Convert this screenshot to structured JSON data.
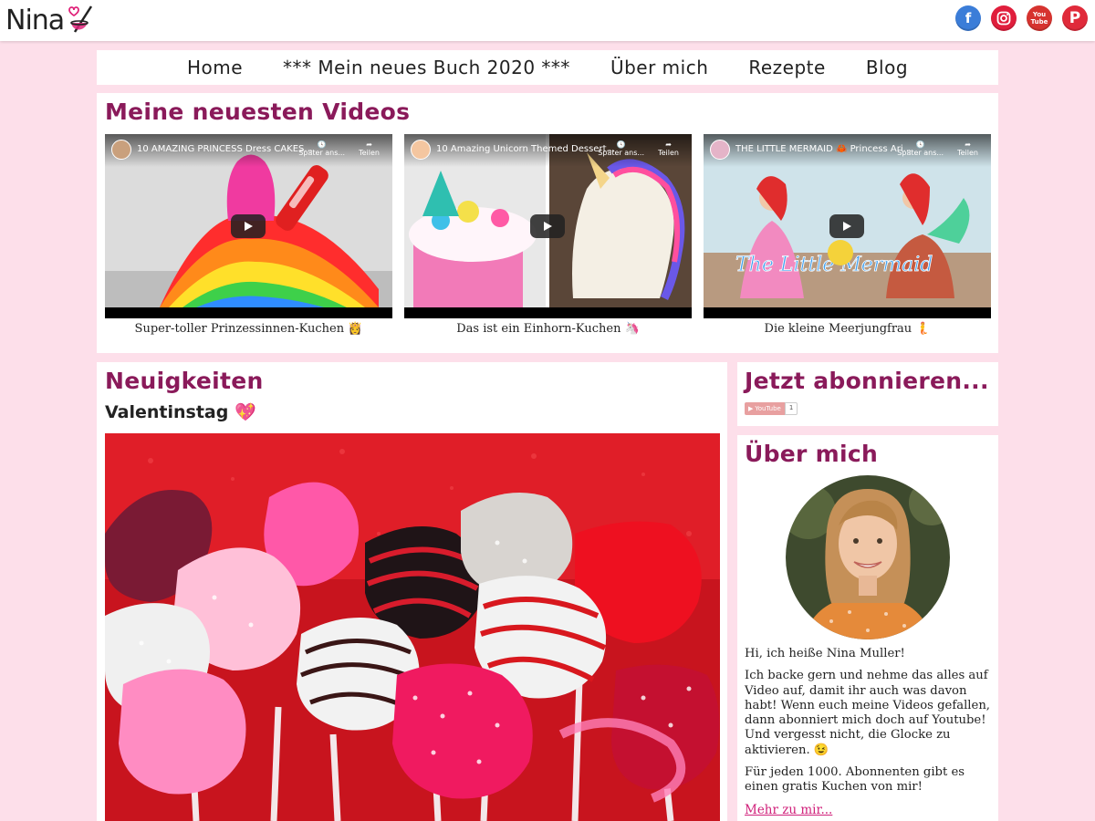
{
  "brand": {
    "logo_text": "Nina"
  },
  "social": [
    {
      "name": "facebook",
      "glyph": "f",
      "color": "#3b7dd8"
    },
    {
      "name": "instagram",
      "glyph": "◎",
      "color": "#e01e3c"
    },
    {
      "name": "youtube",
      "glyph": "You\nTube",
      "color": "#d6332f"
    },
    {
      "name": "pinterest",
      "glyph": "P",
      "color": "#e02a3a"
    }
  ],
  "nav": {
    "items": [
      {
        "label": "Home"
      },
      {
        "label": "*** Mein neues Buch 2020 ***"
      },
      {
        "label": "Über mich"
      },
      {
        "label": "Rezepte"
      },
      {
        "label": "Blog"
      }
    ]
  },
  "videos": {
    "heading": "Meine neuesten Videos",
    "items": [
      {
        "title": "10 AMAZING PRINCESS Dress CAKES...",
        "later": "Später ans...",
        "share": "Teilen",
        "caption": "Super-toller Prinzessinnen-Kuchen 👸"
      },
      {
        "title": "10 Amazing Unicorn Themed Dessert...",
        "later": "Später ans...",
        "share": "Teilen",
        "caption": "Das ist ein Einhorn-Kuchen 🦄"
      },
      {
        "title": "THE LITTLE MERMAID 🦀 Princess Ari...",
        "later": "Später ans...",
        "share": "Teilen",
        "caption": "Die kleine Meerjungfrau 🧜",
        "overlay_text": "The Little Mermaid"
      }
    ]
  },
  "news": {
    "heading": "Neuigkeiten",
    "post_title": "Valentinstag 💖"
  },
  "subscribe": {
    "heading": "Jetzt abonnieren...",
    "button_label": "YouTube",
    "count": "1"
  },
  "about": {
    "heading": "Über mich",
    "greeting": "Hi, ich heiße Nina Muller!",
    "paragraph": "Ich backe gern und nehme das alles auf Video auf, damit ihr auch was davon habt! Wenn euch meine Videos gefallen, dann abonniert mich doch auf Youtube! Und vergesst nicht, die Glocke zu aktivieren. 😉",
    "offer": "Für jeden 1000. Abonnenten gibt es einen gratis Kuchen von mir!",
    "more_link": "Mehr zu mir..."
  },
  "colors": {
    "page_bg": "#fddfea",
    "heading": "#8a1a5a",
    "link": "#d0207a"
  }
}
